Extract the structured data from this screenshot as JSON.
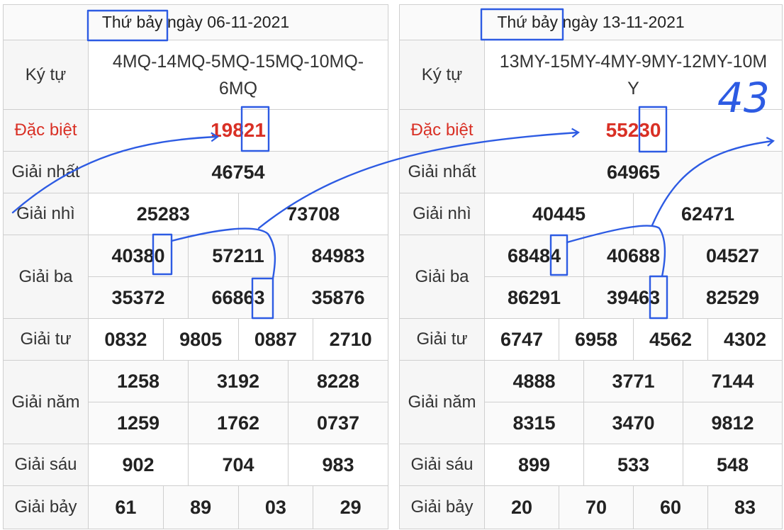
{
  "panels": [
    {
      "date": "Thứ bảy ngày 06-11-2021",
      "labels": {
        "ky_tu": "Ký tự",
        "dac_biet": "Đặc biệt",
        "giai_nhat": "Giải nhất",
        "giai_nhi": "Giải nhì",
        "giai_ba": "Giải ba",
        "giai_tu": "Giải tư",
        "giai_nam": "Giải năm",
        "giai_sau": "Giải sáu",
        "giai_bay": "Giải bảy"
      },
      "ky_tu": "4MQ-14MQ-5MQ-15MQ-10MQ-6MQ",
      "dac_biet": "19821",
      "giai_nhat": "46754",
      "giai_nhi": [
        "25283",
        "73708"
      ],
      "giai_ba": [
        "40380",
        "57211",
        "84983",
        "35372",
        "66863",
        "35876"
      ],
      "giai_tu": [
        "0832",
        "9805",
        "0887",
        "2710"
      ],
      "giai_nam": [
        "1258",
        "3192",
        "8228",
        "1259",
        "1762",
        "0737"
      ],
      "giai_sau": [
        "902",
        "704",
        "983"
      ],
      "giai_bay": [
        "61",
        "89",
        "03",
        "29"
      ]
    },
    {
      "date": "Thứ bảy ngày 13-11-2021",
      "labels": {
        "ky_tu": "Ký tự",
        "dac_biet": "Đặc biệt",
        "giai_nhat": "Giải nhất",
        "giai_nhi": "Giải nhì",
        "giai_ba": "Giải ba",
        "giai_tu": "Giải tư",
        "giai_nam": "Giải năm",
        "giai_sau": "Giải sáu",
        "giai_bay": "Giải bảy"
      },
      "ky_tu": "13MY-15MY-4MY-9MY-12MY-10MY",
      "dac_biet": "55230",
      "giai_nhat": "64965",
      "giai_nhi": [
        "40445",
        "62471"
      ],
      "giai_ba": [
        "68484",
        "40688",
        "04527",
        "86291",
        "39463",
        "82529"
      ],
      "giai_tu": [
        "6747",
        "6958",
        "4562",
        "4302"
      ],
      "giai_nam": [
        "4888",
        "3771",
        "7144",
        "8315",
        "3470",
        "9812"
      ],
      "giai_sau": [
        "899",
        "533",
        "548"
      ],
      "giai_bay": [
        "20",
        "70",
        "60",
        "83"
      ]
    }
  ],
  "annotations": {
    "handwritten_note": "43",
    "ink_color": "#2d5be3",
    "special_color": "#d93025"
  }
}
